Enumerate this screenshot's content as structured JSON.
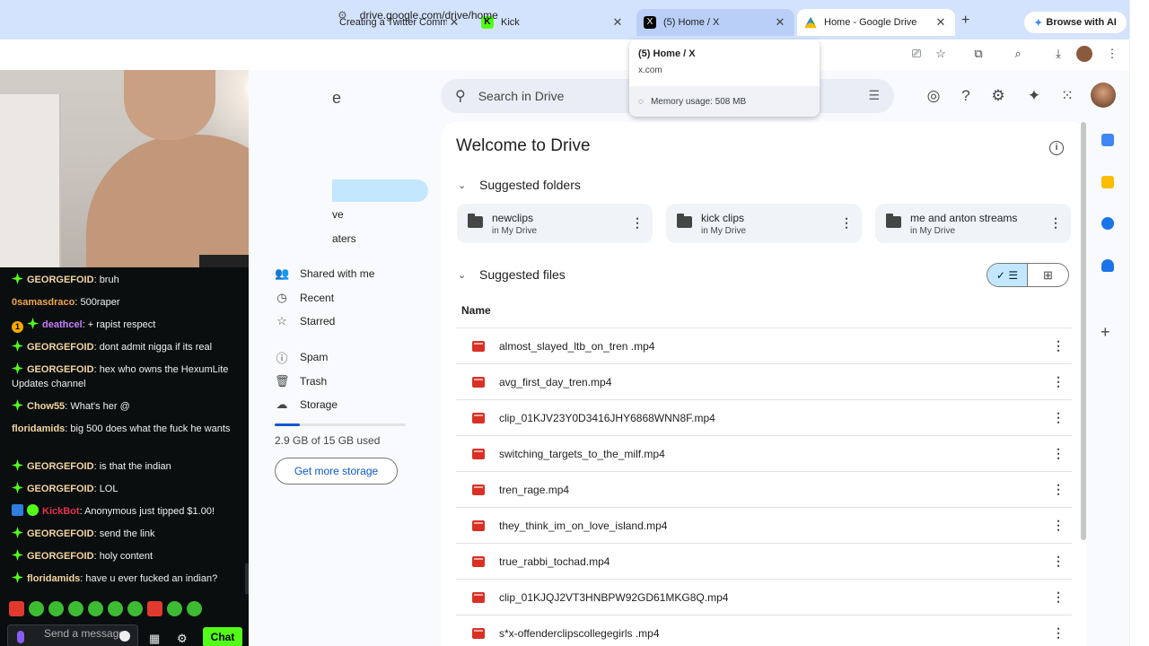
{
  "tabs": [
    {
      "title": "Creating a Twitter Commu",
      "favicon": "x-icon"
    },
    {
      "title": "Kick",
      "favicon": "kick-icon"
    },
    {
      "title": "(5) Home / X",
      "favicon": "x-icon"
    },
    {
      "title": "Home - Google Drive",
      "favicon": "drive-icon"
    }
  ],
  "browse_ai": "Browse with AI",
  "address": "drive.google.com/drive/home",
  "hovercard": {
    "title": "(5) Home / X",
    "domain": "x.com",
    "memory": "Memory usage: 508 MB"
  },
  "drive": {
    "search_placeholder": "Search in Drive",
    "logo_partial": "e",
    "nav_partial": [
      "ve",
      "aters"
    ],
    "nav": [
      {
        "label": "Shared with me",
        "icon": "people-icon"
      },
      {
        "label": "Recent",
        "icon": "clock-icon"
      },
      {
        "label": "Starred",
        "icon": "star-icon"
      },
      {
        "label": "Spam",
        "icon": "spam-icon"
      },
      {
        "label": "Trash",
        "icon": "trash-icon"
      },
      {
        "label": "Storage",
        "icon": "cloud-icon"
      }
    ],
    "storage_used_fraction": 0.19,
    "storage_text": "2.9 GB of 15 GB used",
    "get_storage": "Get more storage",
    "welcome": "Welcome to Drive",
    "suggested_folders": "Suggested folders",
    "folders": [
      {
        "name": "newclips",
        "location": "in My Drive"
      },
      {
        "name": "kick clips",
        "location": "in My Drive"
      },
      {
        "name": "me and anton streams",
        "location": "in My Drive"
      }
    ],
    "suggested_files": "Suggested files",
    "column_name": "Name",
    "files": [
      "almost_slayed_ltb_on_tren .mp4",
      "avg_first_day_tren.mp4",
      "clip_01KJV23Y0D3416JHY6868WNN8F.mp4",
      "switching_targets_to_the_milf.mp4",
      "tren_rage.mp4",
      "they_think_im_on_love_island.mp4",
      "true_rabbi_tochad.mp4",
      "clip_01KJQJ2VT3HNBPW92GD61MKG8Q.mp4",
      "s*x-offenderclipscollegegirls .mp4"
    ]
  },
  "chat": {
    "messages": [
      {
        "badges": [
          "gem"
        ],
        "user": "GEORGEFOID",
        "color": "#f3d5a0",
        "text": "bruh"
      },
      {
        "badges": [],
        "user": "0samasdraco",
        "color": "#f2a54a",
        "text": "500raper"
      },
      {
        "badges": [
          "sub1",
          "gem"
        ],
        "user": "deathcel",
        "color": "#c77dff",
        "text": "+ rapist respect"
      },
      {
        "badges": [
          "gem"
        ],
        "user": "GEORGEFOID",
        "color": "#f3d5a0",
        "text": "dont admit nigga if its real"
      },
      {
        "badges": [
          "gem"
        ],
        "user": "GEORGEFOID",
        "color": "#f3d5a0",
        "text": "hex who owns the HexumLite Updates channel"
      },
      {
        "badges": [
          "gem"
        ],
        "user": "Chow55",
        "color": "#f3d5a0",
        "text": "What's her @"
      },
      {
        "badges": [],
        "user": "floridamids",
        "color": "#f3d5a0",
        "text": "big 500 does what the fuck he wants"
      },
      {
        "badges": [
          "gem"
        ],
        "user": "GEORGEFOID",
        "color": "#f3d5a0",
        "text": "is that the indian"
      },
      {
        "badges": [
          "gem"
        ],
        "user": "GEORGEFOID",
        "color": "#f3d5a0",
        "text": "LOL"
      },
      {
        "badges": [
          "bot",
          "verif"
        ],
        "user": "KickBot",
        "color": "#e5304b",
        "text": "Anonymous just tipped $1.00!"
      },
      {
        "badges": [
          "gem"
        ],
        "user": "GEORGEFOID",
        "color": "#f3d5a0",
        "text": "send the link"
      },
      {
        "badges": [
          "gem"
        ],
        "user": "GEORGEFOID",
        "color": "#f3d5a0",
        "text": "holy content"
      },
      {
        "badges": [
          "gem"
        ],
        "user": "floridamids",
        "color": "#f3d5a0",
        "text": "have u ever fucked an indian?"
      }
    ],
    "input_placeholder": "Send a message",
    "send_label": "Chat"
  }
}
